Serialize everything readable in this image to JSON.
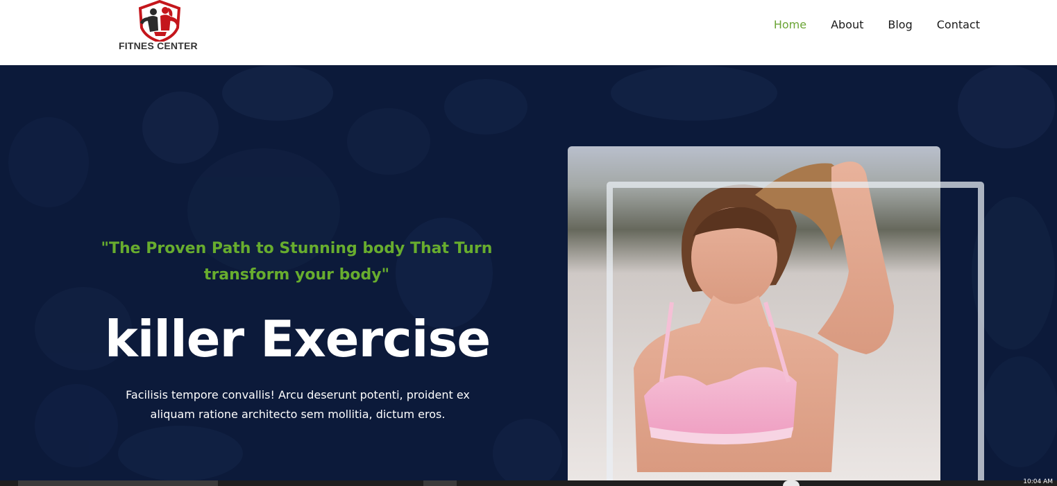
{
  "brand": {
    "logo_text": "FITNES CENTER",
    "logo_colors": {
      "shield": "#c4161c",
      "figures": "#2b2b2b"
    }
  },
  "nav": {
    "items": [
      {
        "label": "Home",
        "active": true
      },
      {
        "label": "About",
        "active": false
      },
      {
        "label": "Blog",
        "active": false
      },
      {
        "label": "Contact",
        "active": false
      }
    ],
    "active_color": "#6aa434"
  },
  "hero": {
    "tagline": "\"The Proven Path to Stunning body That Turn transform your body\"",
    "title": "killer Exercise",
    "description": "Facilisis tempore convallis! Arcu deserunt potenti, proident ex aliquam ratione architecto sem mollitia, dictum eros.",
    "background_color": "#0c1a3a",
    "tagline_color": "#68ad2e"
  },
  "taskbar": {
    "clock": "10:04 AM"
  }
}
